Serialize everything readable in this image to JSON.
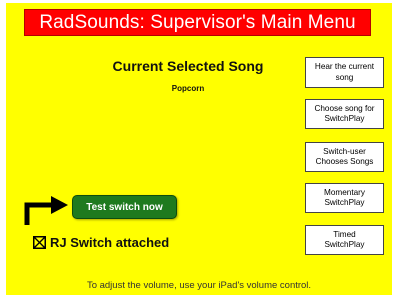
{
  "header": {
    "title": "RadSounds: Supervisor's Main Menu"
  },
  "current": {
    "heading": "Current Selected Song",
    "song": "Popcorn"
  },
  "menu": [
    {
      "label": "Hear the current\nsong"
    },
    {
      "label": "Choose song for\nSwitchPlay"
    },
    {
      "label": "Switch-user\nChooses Songs"
    },
    {
      "label": "Momentary\nSwitchPlay"
    },
    {
      "label": "Timed\nSwitchPlay"
    }
  ],
  "switch": {
    "test_label": "Test switch now",
    "rj_label": "RJ Switch attached",
    "rj_checked": true
  },
  "footer": {
    "text": "To adjust the volume, use your iPad's volume control."
  },
  "colors": {
    "background": "#ffff00",
    "title_bar": "#ff0000",
    "test_button": "#1e7a1e"
  }
}
